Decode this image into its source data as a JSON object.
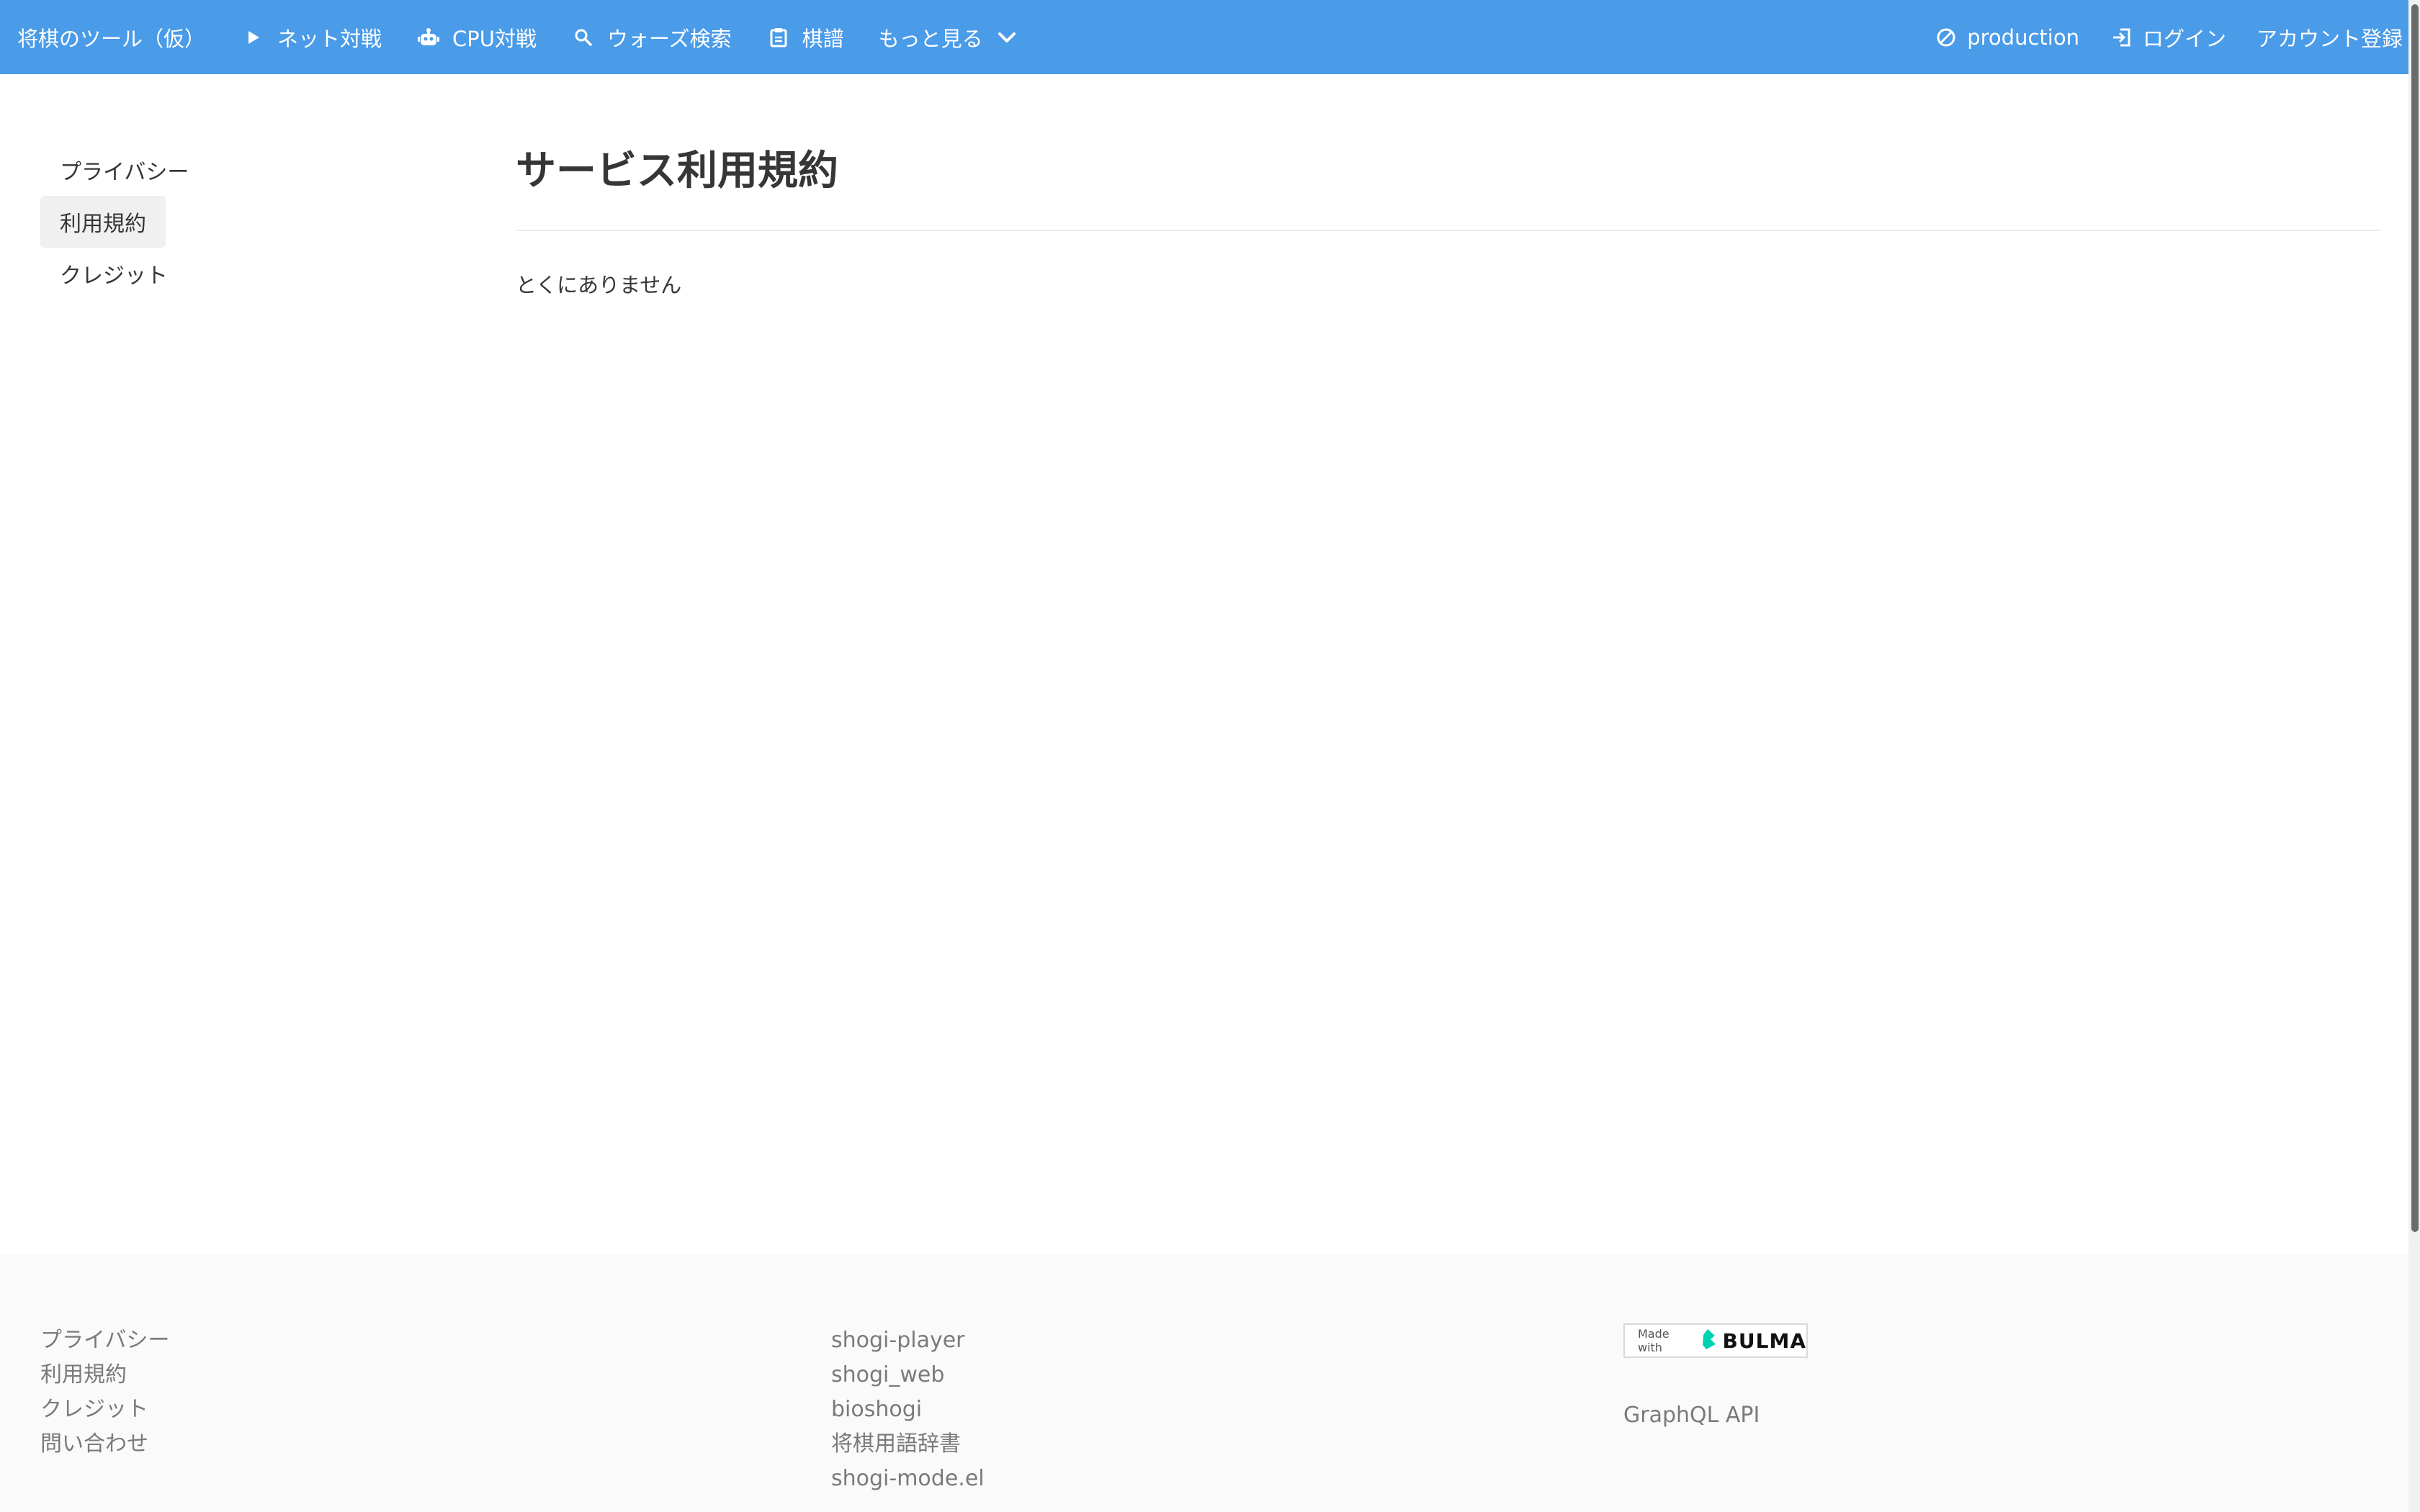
{
  "navbar": {
    "brand": "将棋のツール（仮）",
    "items": [
      {
        "label": "ネット対戦",
        "icon": "play-icon"
      },
      {
        "label": "CPU対戦",
        "icon": "robot-icon"
      },
      {
        "label": "ウォーズ検索",
        "icon": "search-icon"
      },
      {
        "label": "棋譜",
        "icon": "clipboard-icon"
      },
      {
        "label": "もっと見る",
        "icon": "chevron-down-icon"
      }
    ],
    "right": [
      {
        "label": "production",
        "icon": "prohibited-icon"
      },
      {
        "label": "ログイン",
        "icon": "login-icon"
      },
      {
        "label": "アカウント登録"
      }
    ],
    "color": "#4a9be8"
  },
  "sidebar": {
    "items": [
      {
        "label": "プライバシー",
        "active": false
      },
      {
        "label": "利用規約",
        "active": true
      },
      {
        "label": "クレジット",
        "active": false
      }
    ]
  },
  "main": {
    "title": "サービス利用規約",
    "body": "とくにありません"
  },
  "footer": {
    "col1": [
      "プライバシー",
      "利用規約",
      "クレジット",
      "問い合わせ"
    ],
    "col2": [
      "shogi-player",
      "shogi_web",
      "bioshogi",
      "将棋用語辞書",
      "shogi-mode.el"
    ],
    "badge": {
      "made_with": "Made with",
      "brand": "BULMA",
      "color": "#00d1b2"
    },
    "col3": [
      "GraphQL API"
    ]
  }
}
